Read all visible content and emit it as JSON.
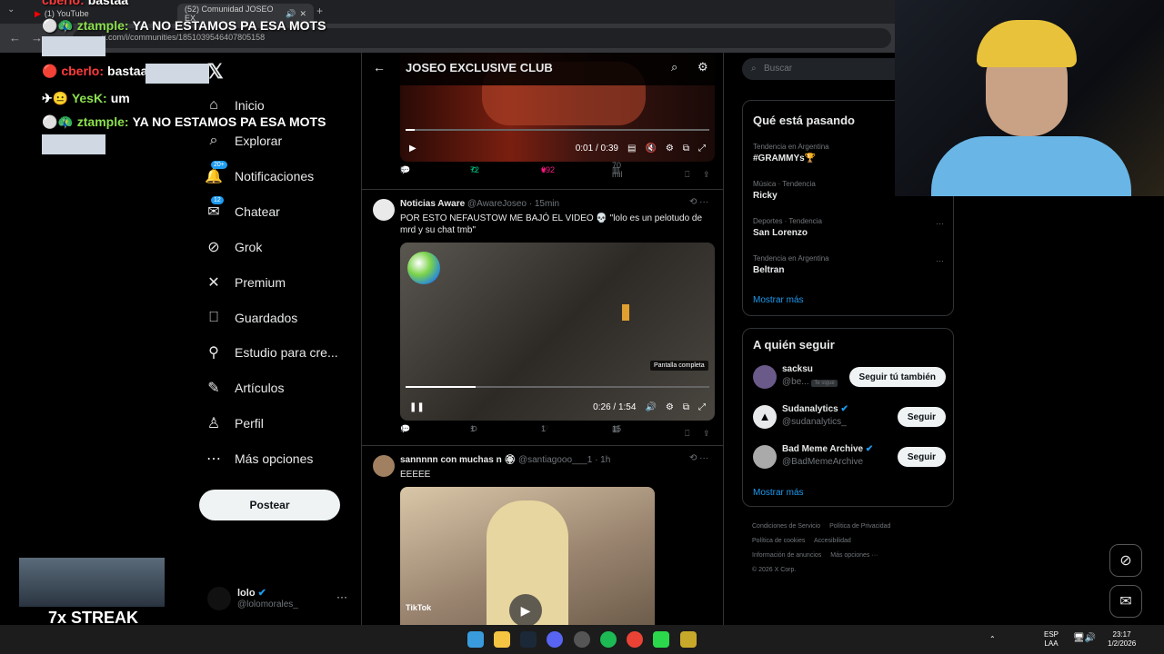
{
  "browser": {
    "tabs": [
      {
        "label": "(1) YouTube"
      },
      {
        "label": "(52) Comunidad JOSEO EX"
      }
    ],
    "url": "x.com/i/communities/1851039546407805158"
  },
  "left_nav": {
    "items": [
      {
        "label": "Inicio",
        "icon": "home-icon"
      },
      {
        "label": "Explorar",
        "icon": "search-icon"
      },
      {
        "label": "Notificaciones",
        "icon": "bell-icon",
        "badge": "20+"
      },
      {
        "label": "Chatear",
        "icon": "mail-icon",
        "badge": "12"
      },
      {
        "label": "Grok",
        "icon": "grok-icon"
      },
      {
        "label": "Premium",
        "icon": "x-icon"
      },
      {
        "label": "Guardados",
        "icon": "bookmark-icon"
      },
      {
        "label": "Estudio para cre...",
        "icon": "studio-icon"
      },
      {
        "label": "Artículos",
        "icon": "article-icon"
      },
      {
        "label": "Perfil",
        "icon": "person-icon"
      },
      {
        "label": "Más opciones",
        "icon": "more-icon"
      }
    ],
    "post_label": "Postear",
    "account": {
      "name": "lolo",
      "handle": "@lolomorales_"
    }
  },
  "community": {
    "title": "JOSEO EXCLUSIVE CLUB"
  },
  "feed": {
    "video1": {
      "time": "0:01 / 0:39",
      "progress": 0.03
    },
    "actions1": {
      "replies": "5",
      "reposts": "72",
      "likes": "692",
      "views": "70 mil"
    },
    "tweet2": {
      "name": "Noticias Aware",
      "handle": "@AwareJoseo",
      "time": "· 15min",
      "text": "POR ESTO NEFAUSTOW ME BAJÓ EL VIDEO 💀 \"lolo es un pelotudo de mrd y su chat tmb\"",
      "video_time": "0:26 / 1:54",
      "video_progress": 0.23,
      "tooltip": "Pantalla completa",
      "actions": {
        "replies": "1",
        "reposts": "1",
        "likes": "1",
        "views": "15"
      }
    },
    "tweet3": {
      "name": "sannnnn con muchas n",
      "handle": "@santiagooo___1",
      "time": "· 1h",
      "text": "EEEEE",
      "video_tag": "TikTok"
    }
  },
  "right": {
    "search_placeholder": "Buscar",
    "trending": {
      "title": "Qué está pasando",
      "items": [
        {
          "meta": "Tendencia en Argentina",
          "name": "#GRAMMYs🏆"
        },
        {
          "meta": "Música · Tendencia",
          "name": "Ricky"
        },
        {
          "meta": "Deportes · Tendencia",
          "name": "San Lorenzo"
        },
        {
          "meta": "Tendencia en Argentina",
          "name": "Beltran"
        }
      ],
      "show_more": "Mostrar más"
    },
    "who_to_follow": {
      "title": "A quién seguir",
      "items": [
        {
          "name": "sacksu",
          "handle": "@be...",
          "follows_you": "Te sigue",
          "button": "Seguir tú también"
        },
        {
          "name": "Sudanalytics",
          "handle": "@sudanalytics_",
          "button": "Seguir"
        },
        {
          "name": "Bad Meme Archive",
          "handle": "@BadMemeArchive",
          "button": "Seguir"
        }
      ],
      "show_more": "Mostrar más"
    },
    "footer": [
      "Condiciones de Servicio",
      "Política de Privacidad",
      "Política de cookies",
      "Accesibilidad",
      "Información de anuncios",
      "Más opciones ···",
      "© 2026 X Corp."
    ]
  },
  "stream": {
    "chat": [
      {
        "user": "cberlo:",
        "msg": "bastaa",
        "color": "#ff3b3b"
      },
      {
        "user": "ztample:",
        "msg": "YA NO ESTAMOS PA ESA MOTS",
        "color": "#8be04e"
      },
      {
        "user": "cberlo:",
        "msg": "bastaa",
        "color": "#ff3b3b"
      },
      {
        "user": "YesK:",
        "msg": "um",
        "color": "#8be04e"
      },
      {
        "user": "ztample:",
        "msg": "YA NO ESTAMOS PA ESA MOTS",
        "color": "#8be04e"
      }
    ],
    "streak": "7x STREAK"
  },
  "taskbar": {
    "lang": "ESP",
    "lang2": "LAA",
    "time": "23:17",
    "date": "1/2/2026"
  }
}
